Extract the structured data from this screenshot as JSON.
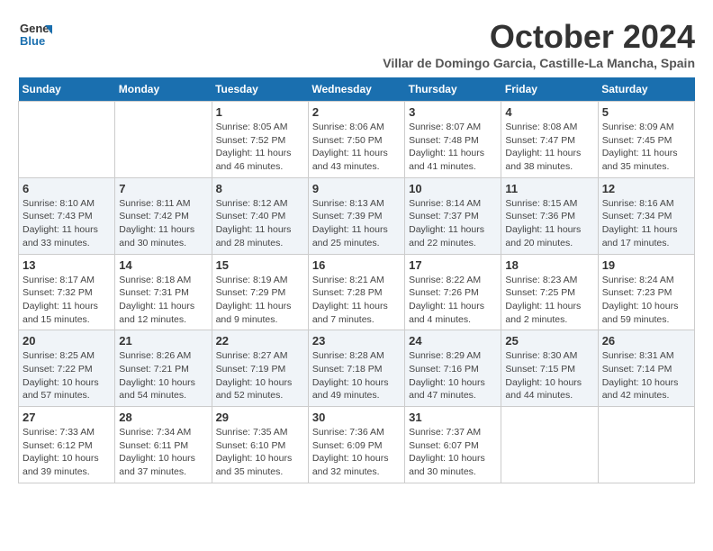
{
  "logo": {
    "line1": "General",
    "line2": "Blue"
  },
  "title": "October 2024",
  "subtitle": "Villar de Domingo Garcia, Castille-La Mancha, Spain",
  "weekdays": [
    "Sunday",
    "Monday",
    "Tuesday",
    "Wednesday",
    "Thursday",
    "Friday",
    "Saturday"
  ],
  "weeks": [
    [
      {
        "day": "",
        "info": ""
      },
      {
        "day": "",
        "info": ""
      },
      {
        "day": "1",
        "info": "Sunrise: 8:05 AM\nSunset: 7:52 PM\nDaylight: 11 hours and 46 minutes."
      },
      {
        "day": "2",
        "info": "Sunrise: 8:06 AM\nSunset: 7:50 PM\nDaylight: 11 hours and 43 minutes."
      },
      {
        "day": "3",
        "info": "Sunrise: 8:07 AM\nSunset: 7:48 PM\nDaylight: 11 hours and 41 minutes."
      },
      {
        "day": "4",
        "info": "Sunrise: 8:08 AM\nSunset: 7:47 PM\nDaylight: 11 hours and 38 minutes."
      },
      {
        "day": "5",
        "info": "Sunrise: 8:09 AM\nSunset: 7:45 PM\nDaylight: 11 hours and 35 minutes."
      }
    ],
    [
      {
        "day": "6",
        "info": "Sunrise: 8:10 AM\nSunset: 7:43 PM\nDaylight: 11 hours and 33 minutes."
      },
      {
        "day": "7",
        "info": "Sunrise: 8:11 AM\nSunset: 7:42 PM\nDaylight: 11 hours and 30 minutes."
      },
      {
        "day": "8",
        "info": "Sunrise: 8:12 AM\nSunset: 7:40 PM\nDaylight: 11 hours and 28 minutes."
      },
      {
        "day": "9",
        "info": "Sunrise: 8:13 AM\nSunset: 7:39 PM\nDaylight: 11 hours and 25 minutes."
      },
      {
        "day": "10",
        "info": "Sunrise: 8:14 AM\nSunset: 7:37 PM\nDaylight: 11 hours and 22 minutes."
      },
      {
        "day": "11",
        "info": "Sunrise: 8:15 AM\nSunset: 7:36 PM\nDaylight: 11 hours and 20 minutes."
      },
      {
        "day": "12",
        "info": "Sunrise: 8:16 AM\nSunset: 7:34 PM\nDaylight: 11 hours and 17 minutes."
      }
    ],
    [
      {
        "day": "13",
        "info": "Sunrise: 8:17 AM\nSunset: 7:32 PM\nDaylight: 11 hours and 15 minutes."
      },
      {
        "day": "14",
        "info": "Sunrise: 8:18 AM\nSunset: 7:31 PM\nDaylight: 11 hours and 12 minutes."
      },
      {
        "day": "15",
        "info": "Sunrise: 8:19 AM\nSunset: 7:29 PM\nDaylight: 11 hours and 9 minutes."
      },
      {
        "day": "16",
        "info": "Sunrise: 8:21 AM\nSunset: 7:28 PM\nDaylight: 11 hours and 7 minutes."
      },
      {
        "day": "17",
        "info": "Sunrise: 8:22 AM\nSunset: 7:26 PM\nDaylight: 11 hours and 4 minutes."
      },
      {
        "day": "18",
        "info": "Sunrise: 8:23 AM\nSunset: 7:25 PM\nDaylight: 11 hours and 2 minutes."
      },
      {
        "day": "19",
        "info": "Sunrise: 8:24 AM\nSunset: 7:23 PM\nDaylight: 10 hours and 59 minutes."
      }
    ],
    [
      {
        "day": "20",
        "info": "Sunrise: 8:25 AM\nSunset: 7:22 PM\nDaylight: 10 hours and 57 minutes."
      },
      {
        "day": "21",
        "info": "Sunrise: 8:26 AM\nSunset: 7:21 PM\nDaylight: 10 hours and 54 minutes."
      },
      {
        "day": "22",
        "info": "Sunrise: 8:27 AM\nSunset: 7:19 PM\nDaylight: 10 hours and 52 minutes."
      },
      {
        "day": "23",
        "info": "Sunrise: 8:28 AM\nSunset: 7:18 PM\nDaylight: 10 hours and 49 minutes."
      },
      {
        "day": "24",
        "info": "Sunrise: 8:29 AM\nSunset: 7:16 PM\nDaylight: 10 hours and 47 minutes."
      },
      {
        "day": "25",
        "info": "Sunrise: 8:30 AM\nSunset: 7:15 PM\nDaylight: 10 hours and 44 minutes."
      },
      {
        "day": "26",
        "info": "Sunrise: 8:31 AM\nSunset: 7:14 PM\nDaylight: 10 hours and 42 minutes."
      }
    ],
    [
      {
        "day": "27",
        "info": "Sunrise: 7:33 AM\nSunset: 6:12 PM\nDaylight: 10 hours and 39 minutes."
      },
      {
        "day": "28",
        "info": "Sunrise: 7:34 AM\nSunset: 6:11 PM\nDaylight: 10 hours and 37 minutes."
      },
      {
        "day": "29",
        "info": "Sunrise: 7:35 AM\nSunset: 6:10 PM\nDaylight: 10 hours and 35 minutes."
      },
      {
        "day": "30",
        "info": "Sunrise: 7:36 AM\nSunset: 6:09 PM\nDaylight: 10 hours and 32 minutes."
      },
      {
        "day": "31",
        "info": "Sunrise: 7:37 AM\nSunset: 6:07 PM\nDaylight: 10 hours and 30 minutes."
      },
      {
        "day": "",
        "info": ""
      },
      {
        "day": "",
        "info": ""
      }
    ]
  ]
}
